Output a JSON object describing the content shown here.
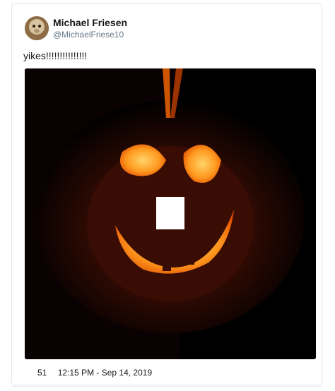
{
  "tweet": {
    "author_name": "Michael Friesen",
    "author_handle": "@MichaelFriese10",
    "text": "yikes!!!!!!!!!!!!!!!",
    "likes": "51",
    "timestamp": "12:15 PM - Sep 14, 2019"
  },
  "media": {
    "description_icon": "pumpkin-photo"
  }
}
